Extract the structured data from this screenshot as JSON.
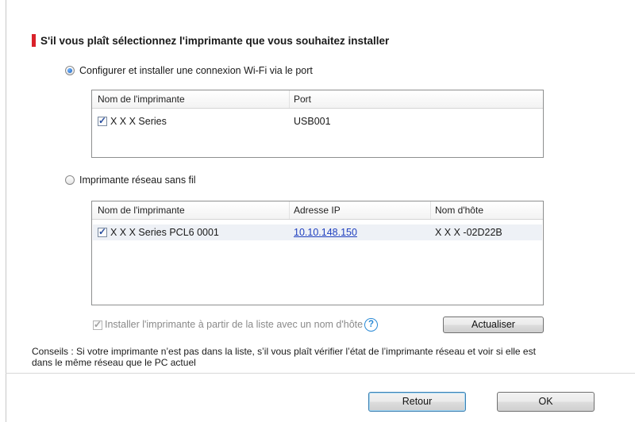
{
  "heading": {
    "text": "S'il vous plaît sélectionnez l'imprimante que vous souhaitez installer",
    "accent_color": "#d9222a"
  },
  "option_wifi_port": {
    "label": "Configurer et installer une connexion Wi-Fi via le port",
    "selected": true,
    "columns": [
      "Nom de l'imprimante",
      "Port"
    ],
    "rows": [
      {
        "checked": true,
        "name": "X X X  Series",
        "port": "USB001"
      }
    ]
  },
  "option_wireless": {
    "label": "Imprimante réseau sans fil",
    "selected": false,
    "columns": [
      "Nom de l'imprimante",
      "Adresse IP",
      "Nom d'hôte"
    ],
    "rows": [
      {
        "checked": true,
        "name": "X X X  Series PCL6 0001",
        "ip": "10.10.148.150",
        "host": "X X X -02D22B"
      }
    ],
    "install_by_hostname_label": "Installer l'imprimante à partir de la liste avec un nom d'hôte",
    "help_label": "?",
    "refresh_label": "Actualiser"
  },
  "tip": {
    "line1": "Conseils : Si votre imprimante n’est pas dans la liste, s’il vous plaît vérifier l’état de l’imprimante réseau et voir si elle est",
    "line2": "dans le même réseau que le PC actuel"
  },
  "footer": {
    "back_label": "Retour",
    "ok_label": "OK"
  }
}
